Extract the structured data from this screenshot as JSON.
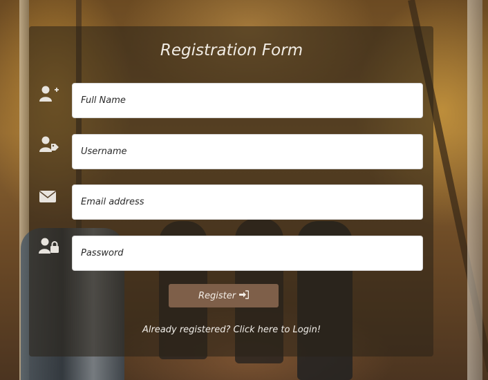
{
  "form": {
    "title": "Registration Form",
    "fields": [
      {
        "icon": "add-user-icon",
        "placeholder": "Full Name",
        "value": ""
      },
      {
        "icon": "user-tag-icon",
        "placeholder": "Username",
        "value": ""
      },
      {
        "icon": "envelope-icon",
        "placeholder": "Email address",
        "value": ""
      },
      {
        "icon": "user-lock-icon",
        "placeholder": "Password",
        "value": ""
      }
    ],
    "register_label": "Register",
    "register_icon": "sign-in-icon",
    "login_link": "Already registered? Click here to Login!"
  },
  "colors": {
    "card_overlay": "#2a2218",
    "button": "#7e5f49",
    "icon": "#e8e4de",
    "text_light": "#f1ece4"
  }
}
